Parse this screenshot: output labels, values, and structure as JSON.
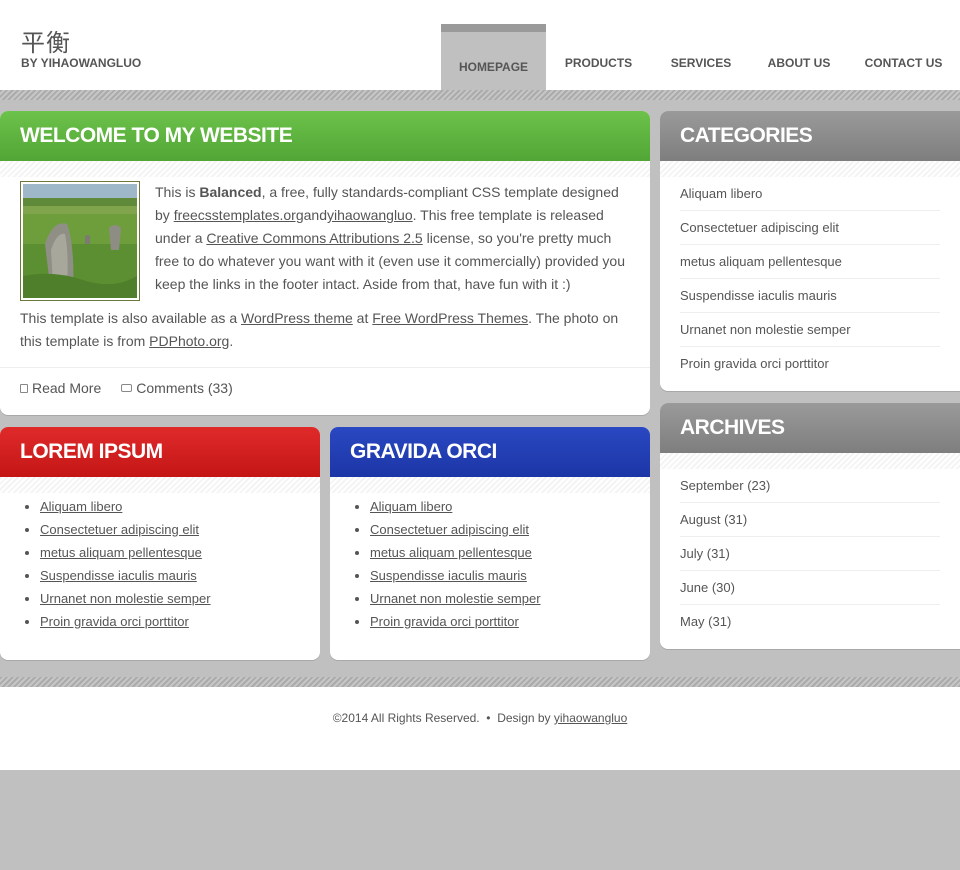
{
  "header": {
    "logo_title": "平衡",
    "logo_sub": "BY YIHAOWANGLUO",
    "nav": [
      "HOMEPAGE",
      "PRODUCTS",
      "SERVICES",
      "ABOUT US",
      "CONTACT US"
    ]
  },
  "welcome": {
    "title": "WELCOME TO MY WEBSITE",
    "p1_a": "This is ",
    "p1_bold": "Balanced",
    "p1_b": ", a free, fully standards-compliant CSS template designed by ",
    "p1_link1": "freecsstemplates.org",
    "p1_and": "and",
    "p1_link2": "yihaowangluo",
    "p1_c": ". This free template is released under a ",
    "p1_link3": "Creative Commons Attributions 2.5",
    "p1_d": " license, so you're pretty much free to do whatever you want with it (even use it commercially) provided you keep the links in the footer intact. Aside from that, have fun with it :)",
    "p2_a": "This template is also available as a ",
    "p2_link1": "WordPress theme",
    "p2_b": " at ",
    "p2_link2": "Free WordPress Themes",
    "p2_c": ". The photo on this template is from ",
    "p2_link3": "PDPhoto.org",
    "p2_d": ".",
    "read_more": "Read More",
    "comments": "Comments (33)"
  },
  "lorem": {
    "title": "LOREM IPSUM",
    "items": [
      "Aliquam libero",
      "Consectetuer adipiscing elit",
      "metus aliquam pellentesque",
      "Suspendisse iaculis mauris",
      "Urnanet non molestie semper",
      "Proin gravida orci porttitor"
    ]
  },
  "gravida": {
    "title": "GRAVIDA ORCI",
    "items": [
      "Aliquam libero",
      "Consectetuer adipiscing elit",
      "metus aliquam pellentesque",
      "Suspendisse iaculis mauris",
      "Urnanet non molestie semper",
      "Proin gravida orci porttitor"
    ]
  },
  "categories": {
    "title": "CATEGORIES",
    "items": [
      "Aliquam libero",
      "Consectetuer adipiscing elit",
      "metus aliquam pellentesque",
      "Suspendisse iaculis mauris",
      "Urnanet non molestie semper",
      "Proin gravida orci porttitor"
    ]
  },
  "archives": {
    "title": "ARCHIVES",
    "items": [
      {
        "month": "September",
        "count": " (23)"
      },
      {
        "month": "August",
        "count": " (31)"
      },
      {
        "month": "July",
        "count": " (31)"
      },
      {
        "month": "June",
        "count": " (30)"
      },
      {
        "month": "May",
        "count": " (31)"
      }
    ]
  },
  "footer": {
    "copyright": "©2014 All Rights Reserved.",
    "separator": "  •  ",
    "design_by": "Design by ",
    "designer": "yihaowangluo"
  },
  "colors": {
    "green": "#5bb23e",
    "red": "#d21f1f",
    "blue": "#2340b5",
    "gray": "#8a8a8a",
    "background": "#c0c0c0"
  }
}
